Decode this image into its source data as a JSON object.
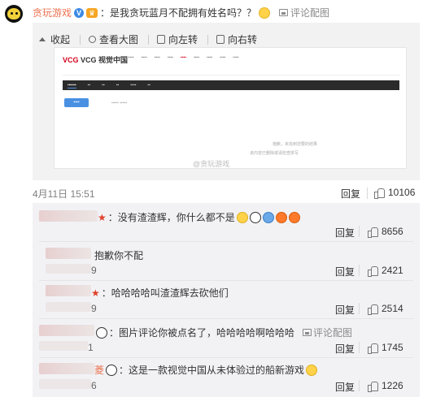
{
  "post": {
    "author": "贪玩游戏",
    "text": "：是我贪玩蓝月不配拥有姓名吗？？",
    "image_comment_link": "评论配图",
    "date": "4月11日 15:51",
    "repost_label": "回复",
    "like_count": "10106"
  },
  "viewer": {
    "tools": [
      "收起",
      "查看大图",
      "向左转",
      "向右转"
    ],
    "shot": {
      "logo": "VCG 视觉中国",
      "empty_line1": "抱歉，未找到您要的结果",
      "empty_line2": "该内容已删除或请检查拼写",
      "watermark": "@贪玩游戏"
    }
  },
  "comments": [
    {
      "text": "：没有渣渣辉，你什么都不是",
      "id_suffix": "",
      "reply": "回复",
      "likes": "8656"
    },
    {
      "text": "抱歉你不配",
      "id_suffix": "9",
      "reply": "回复",
      "likes": "2421"
    },
    {
      "text": "：哈哈哈哈叫渣渣辉去砍他们",
      "id_suffix": "9",
      "reply": "回复",
      "likes": "2514"
    },
    {
      "text": "：图片评论你被点名了，哈哈哈哈啊哈哈哈",
      "id_suffix": "1",
      "link": "评论配图",
      "reply": "回复",
      "likes": "1745"
    },
    {
      "text": "：这是一款视觉中国从未体验过的船新游戏",
      "name_tail": "菱",
      "id_suffix": "6",
      "reply": "回复",
      "likes": "1226"
    }
  ]
}
